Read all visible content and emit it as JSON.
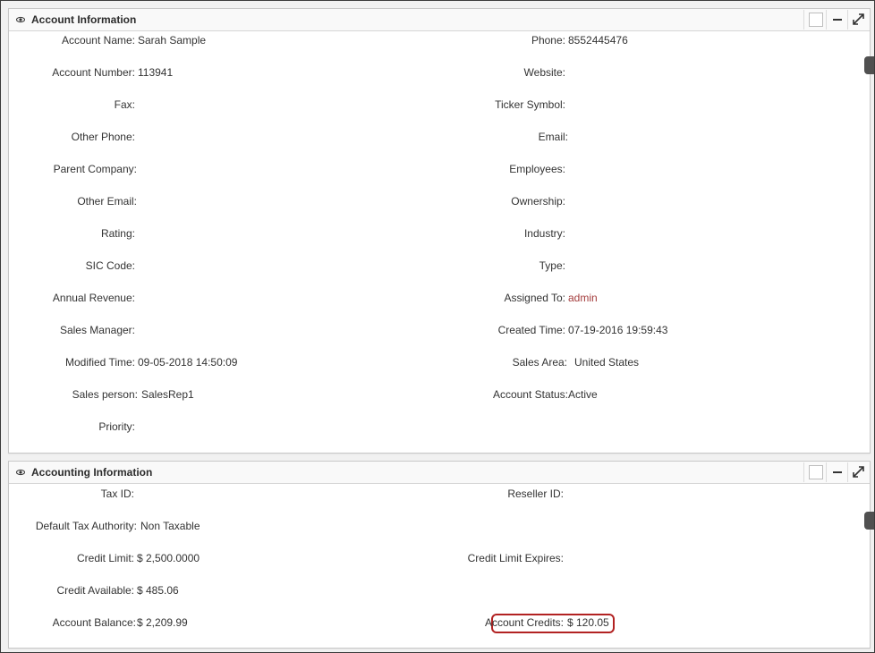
{
  "account_panel": {
    "title": "Account Information",
    "left": [
      {
        "label": "Account Name:",
        "value": "Sarah Sample"
      },
      {
        "label": "Account Number:",
        "value": "113941"
      },
      {
        "label": "Fax:",
        "value": ""
      },
      {
        "label": "Other Phone:",
        "value": ""
      },
      {
        "label": "Parent Company:",
        "value": ""
      },
      {
        "label": "Other Email:",
        "value": ""
      },
      {
        "label": "Rating:",
        "value": ""
      },
      {
        "label": "SIC Code:",
        "value": ""
      },
      {
        "label": "Annual Revenue:",
        "value": ""
      },
      {
        "label": "Sales Manager:",
        "value": ""
      },
      {
        "label": "Modified Time:",
        "value": "09-05-2018 14:50:09"
      },
      {
        "label": "Sales person:",
        "value": "SalesRep1"
      },
      {
        "label": "Priority:",
        "value": ""
      }
    ],
    "right": [
      {
        "label": "Phone:",
        "value": "8552445476"
      },
      {
        "label": "Website:",
        "value": ""
      },
      {
        "label": "Ticker Symbol:",
        "value": ""
      },
      {
        "label": "Email:",
        "value": ""
      },
      {
        "label": "Employees:",
        "value": ""
      },
      {
        "label": "Ownership:",
        "value": ""
      },
      {
        "label": "Industry:",
        "value": ""
      },
      {
        "label": "Type:",
        "value": ""
      },
      {
        "label": "Assigned To:",
        "value": "admin"
      },
      {
        "label": "Created Time:",
        "value": "07-19-2016 19:59:43"
      },
      {
        "label": "Sales Area:",
        "value": "United States"
      },
      {
        "label": "Account Status:",
        "value": "Active"
      }
    ]
  },
  "accounting_panel": {
    "title": "Accounting Information",
    "left": [
      {
        "label": "Tax ID:",
        "value": ""
      },
      {
        "label": "Default Tax Authority:",
        "value": "Non Taxable"
      },
      {
        "label": "Credit Limit:",
        "value": "$ 2,500.0000"
      },
      {
        "label": "Credit Available:",
        "value": "$ 485.06"
      },
      {
        "label": "Account Balance:",
        "value": "$ 2,209.99"
      }
    ],
    "right": [
      {
        "label": "Reseller ID:",
        "value": ""
      },
      {
        "label": "Credit Limit Expires:",
        "value": ""
      },
      {
        "label": "Account Credits:",
        "value": "$ 120.05"
      }
    ]
  },
  "colors": {
    "link": "#a43d3d",
    "highlight_border": "#b22222"
  },
  "icons": {
    "panel_toggle": "eye-icon",
    "select": "checkbox-icon",
    "minimize": "minus-icon",
    "maximize": "expand-icon"
  }
}
